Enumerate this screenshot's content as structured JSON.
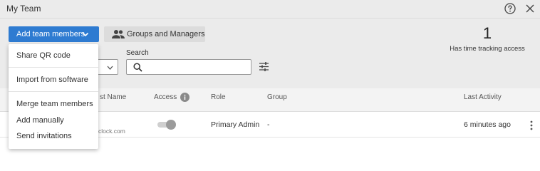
{
  "window": {
    "title": "My Team"
  },
  "toolbar": {
    "add_members_label": "Add team members",
    "groups_label": "Groups and Managers",
    "search_label": "Search",
    "search_value": "",
    "search_placeholder": ""
  },
  "stats": {
    "count": "1",
    "label": "Has time tracking access"
  },
  "table": {
    "headers": {
      "name": "st Name",
      "access": "Access",
      "role": "Role",
      "group": "Group",
      "activity": "Last Activity"
    },
    "rows": [
      {
        "email": "clock.com",
        "access_enabled": true,
        "role": "Primary Admin",
        "group": "-",
        "last_activity": "6 minutes ago"
      }
    ]
  },
  "dropdown": {
    "items": [
      "Share QR code",
      "Import from software",
      "Merge team members",
      "Add manually",
      "Send invitations"
    ]
  },
  "colors": {
    "accent": "#2e7bd1",
    "header_bg": "#ebebeb"
  },
  "icons": [
    "help-icon",
    "close-icon",
    "chevron-down-icon",
    "people-icon",
    "search-icon",
    "filter-icon",
    "info-icon",
    "kebab-menu-icon"
  ]
}
